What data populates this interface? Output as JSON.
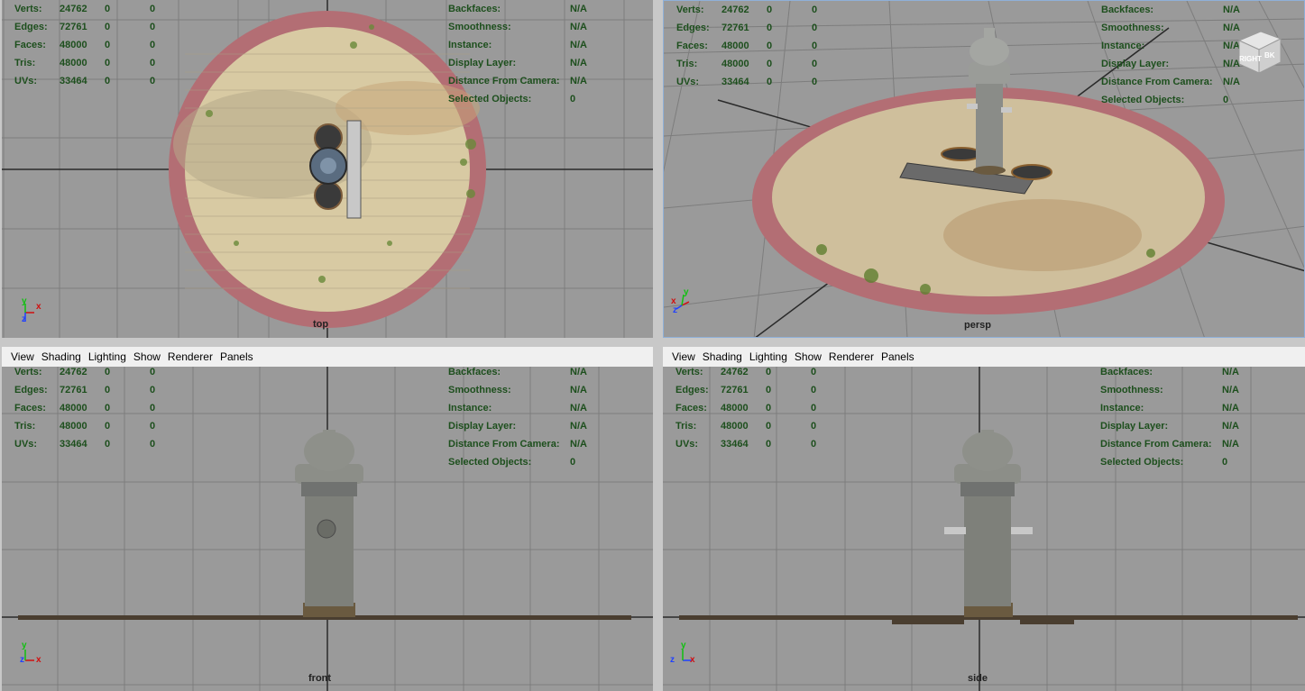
{
  "menu": [
    "View",
    "Shading",
    "Lighting",
    "Show",
    "Renderer",
    "Panels"
  ],
  "stats_left": [
    {
      "label": "Verts:",
      "a": "24762",
      "b": "0",
      "c": "0"
    },
    {
      "label": "Edges:",
      "a": "72761",
      "b": "0",
      "c": "0"
    },
    {
      "label": "Faces:",
      "a": "48000",
      "b": "0",
      "c": "0"
    },
    {
      "label": "Tris:",
      "a": "48000",
      "b": "0",
      "c": "0"
    },
    {
      "label": "UVs:",
      "a": "33464",
      "b": "0",
      "c": "0"
    }
  ],
  "stats_right": [
    {
      "label": "Backfaces:",
      "value": "N/A"
    },
    {
      "label": "Smoothness:",
      "value": "N/A"
    },
    {
      "label": "Instance:",
      "value": "N/A"
    },
    {
      "label": "Display Layer:",
      "value": "N/A"
    },
    {
      "label": "Distance From Camera:",
      "value": "N/A"
    },
    {
      "label": "Selected Objects:",
      "value": "0"
    }
  ],
  "cameras": {
    "top": "top",
    "persp": "persp",
    "front": "front",
    "side": "side"
  },
  "axes": {
    "x": "x",
    "y": "y",
    "z": "z"
  },
  "viewcube": {
    "face1": "RIGHT",
    "face2": "BK"
  },
  "colors": {
    "viewport_bg": "#9a9a9a",
    "hud_text": "#1d4f1d",
    "grid": "#7a7a7a",
    "axis_x": "#d01010",
    "axis_y": "#10c010",
    "axis_z": "#2040ff"
  }
}
